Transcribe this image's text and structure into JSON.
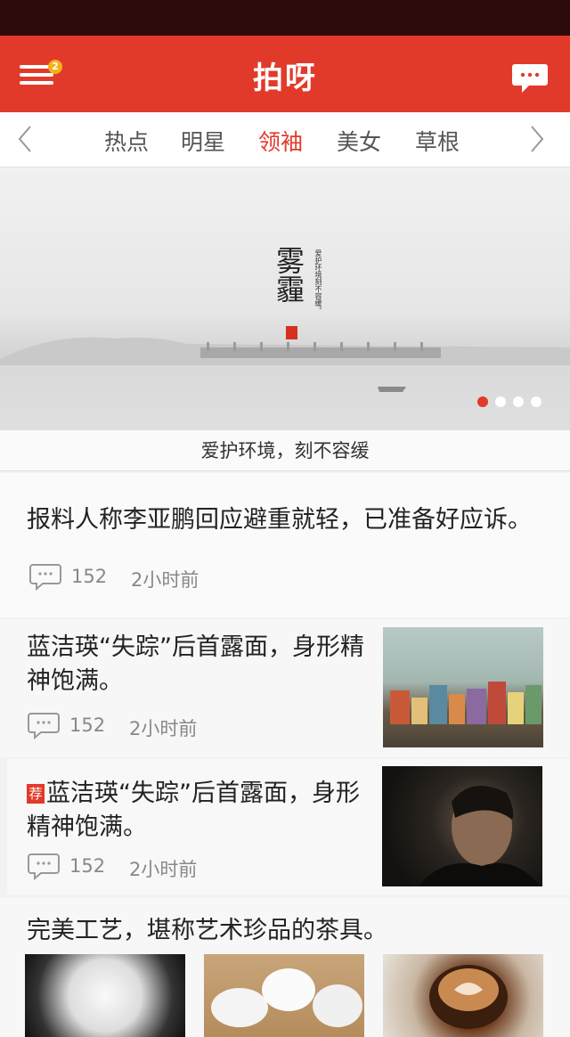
{
  "header": {
    "title": "拍呀",
    "menu_badge": "2"
  },
  "tabs": {
    "items": [
      "热点",
      "明星",
      "领袖",
      "美女",
      "草根"
    ],
    "active_index": 2
  },
  "banner": {
    "title": "雾霾",
    "subtitle": "爱护环境刻不容缓。",
    "caption": "爱护环境，刻不容缓",
    "slide_count": 4,
    "active_slide": 1
  },
  "feed": [
    {
      "headline": "报料人称李亚鹏回应避重就轻，已准备好应诉。",
      "comments": "152",
      "time": "2小时前"
    },
    {
      "headline": "蓝洁瑛“失踪”后首露面，身形精神饱满。",
      "comments": "152",
      "time": "2小时前",
      "thumb": "houses-photo"
    },
    {
      "tag": "荐",
      "headline": "蓝洁瑛“失踪”后首露面，身形精神饱满。",
      "comments": "152",
      "time": "2小时前",
      "thumb": "portrait-photo"
    },
    {
      "headline": "完美工艺，堪称艺术珍品的茶具。",
      "thumbs": [
        "white-cups-photo",
        "white-bowls-photo",
        "latte-photo"
      ]
    }
  ],
  "colors": {
    "brand": "#e23a2a",
    "statusbar": "#2e0b0b",
    "badge": "#f5b21b"
  }
}
